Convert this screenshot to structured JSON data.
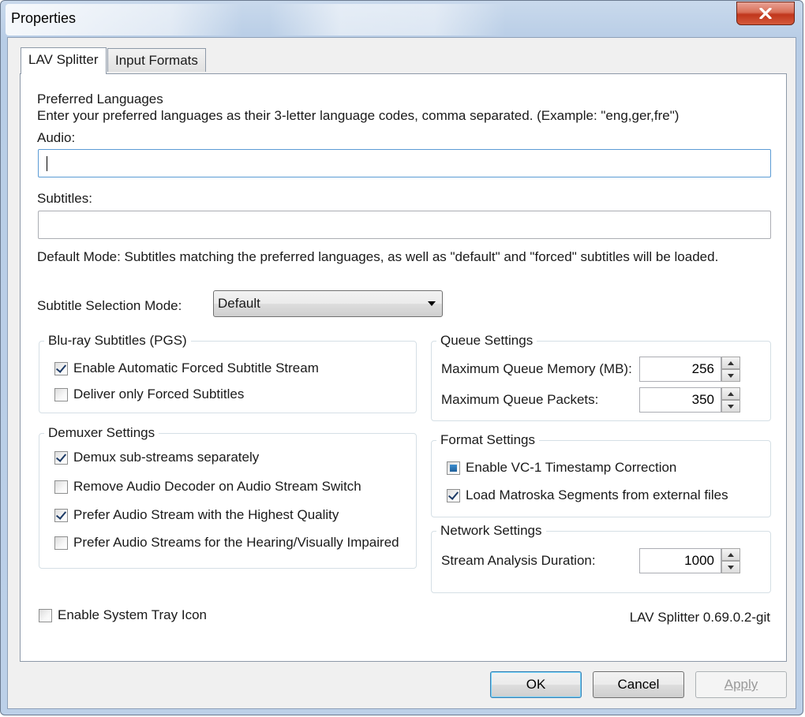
{
  "window": {
    "title": "Properties"
  },
  "tabs": [
    {
      "label": "LAV Splitter",
      "active": true
    },
    {
      "label": "Input Formats",
      "active": false
    }
  ],
  "languages": {
    "heading": "Preferred Languages",
    "description": "Enter your preferred languages as their 3-letter language codes, comma separated. (Example: \"eng,ger,fre\")",
    "audio_label": "Audio:",
    "audio_value": "",
    "subtitles_label": "Subtitles:",
    "subtitles_value": "",
    "default_mode_note": "Default Mode: Subtitles matching the preferred languages, as well as \"default\" and \"forced\" subtitles will be loaded."
  },
  "subtitle_selection": {
    "label": "Subtitle Selection Mode:",
    "value": "Default"
  },
  "bluray": {
    "title": "Blu-ray Subtitles (PGS)",
    "items": [
      {
        "label": "Enable Automatic Forced Subtitle Stream",
        "checked": true
      },
      {
        "label": "Deliver only Forced Subtitles",
        "checked": false
      }
    ]
  },
  "demuxer": {
    "title": "Demuxer Settings",
    "items": [
      {
        "label": "Demux sub-streams separately",
        "checked": true
      },
      {
        "label": "Remove Audio Decoder on Audio Stream Switch",
        "checked": false
      },
      {
        "label": "Prefer Audio Stream with the Highest Quality",
        "checked": true
      },
      {
        "label": "Prefer Audio Streams for the Hearing/Visually Impaired",
        "checked": false
      }
    ]
  },
  "queue": {
    "title": "Queue Settings",
    "memory_label": "Maximum Queue Memory (MB):",
    "memory_value": "256",
    "packets_label": "Maximum Queue Packets:",
    "packets_value": "350"
  },
  "format": {
    "title": "Format Settings",
    "items": [
      {
        "label": "Enable VC-1 Timestamp Correction",
        "state": "indeterminate"
      },
      {
        "label": "Load Matroska Segments from external files",
        "state": "checked"
      }
    ]
  },
  "network": {
    "title": "Network Settings",
    "duration_label": "Stream Analysis Duration:",
    "duration_value": "1000"
  },
  "tray": {
    "label": "Enable System Tray Icon",
    "checked": false
  },
  "version": "LAV Splitter 0.69.0.2-git",
  "buttons": {
    "ok": "OK",
    "cancel": "Cancel",
    "apply": "Apply"
  }
}
